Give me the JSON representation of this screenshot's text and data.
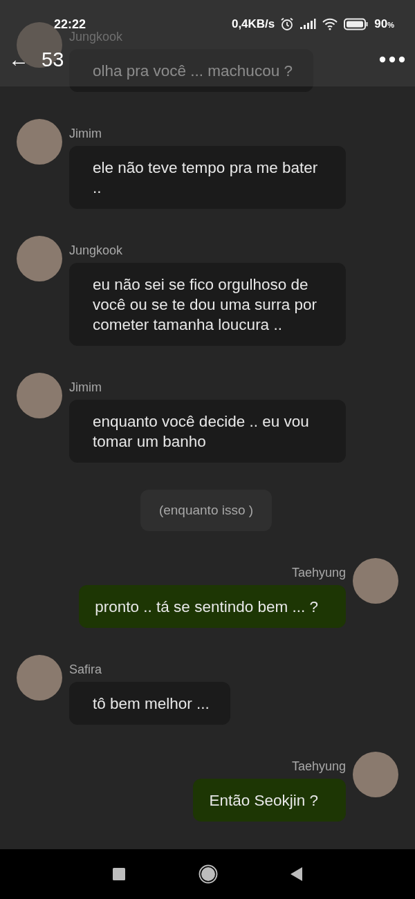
{
  "status_bar": {
    "time": "22:22",
    "speed": "0,4KB/s",
    "battery": "90",
    "battery_unit": "%"
  },
  "header": {
    "back": "←",
    "count": "53"
  },
  "messages": [
    {
      "kind": "received",
      "sender": "Jungkook",
      "text": "olha pra você ... machucou ?"
    },
    {
      "kind": "received",
      "sender": "Jimim",
      "text": "ele não teve tempo pra me bater .."
    },
    {
      "kind": "received",
      "sender": "Jungkook",
      "text": "eu não sei se fico orgulhoso de você ou se te dou uma surra por cometer tamanha loucura .."
    },
    {
      "kind": "received",
      "sender": "Jimim",
      "text": "enquanto você decide .. eu vou tomar um banho"
    },
    {
      "kind": "system",
      "text": "(enquanto isso )"
    },
    {
      "kind": "sent",
      "sender": "Taehyung",
      "text": "pronto .. tá se sentindo bem ... ?"
    },
    {
      "kind": "received",
      "sender": "Safira",
      "text": "tô bem melhor ..."
    },
    {
      "kind": "sent",
      "sender": "Taehyung",
      "text": "Então Seokjin ?"
    }
  ]
}
